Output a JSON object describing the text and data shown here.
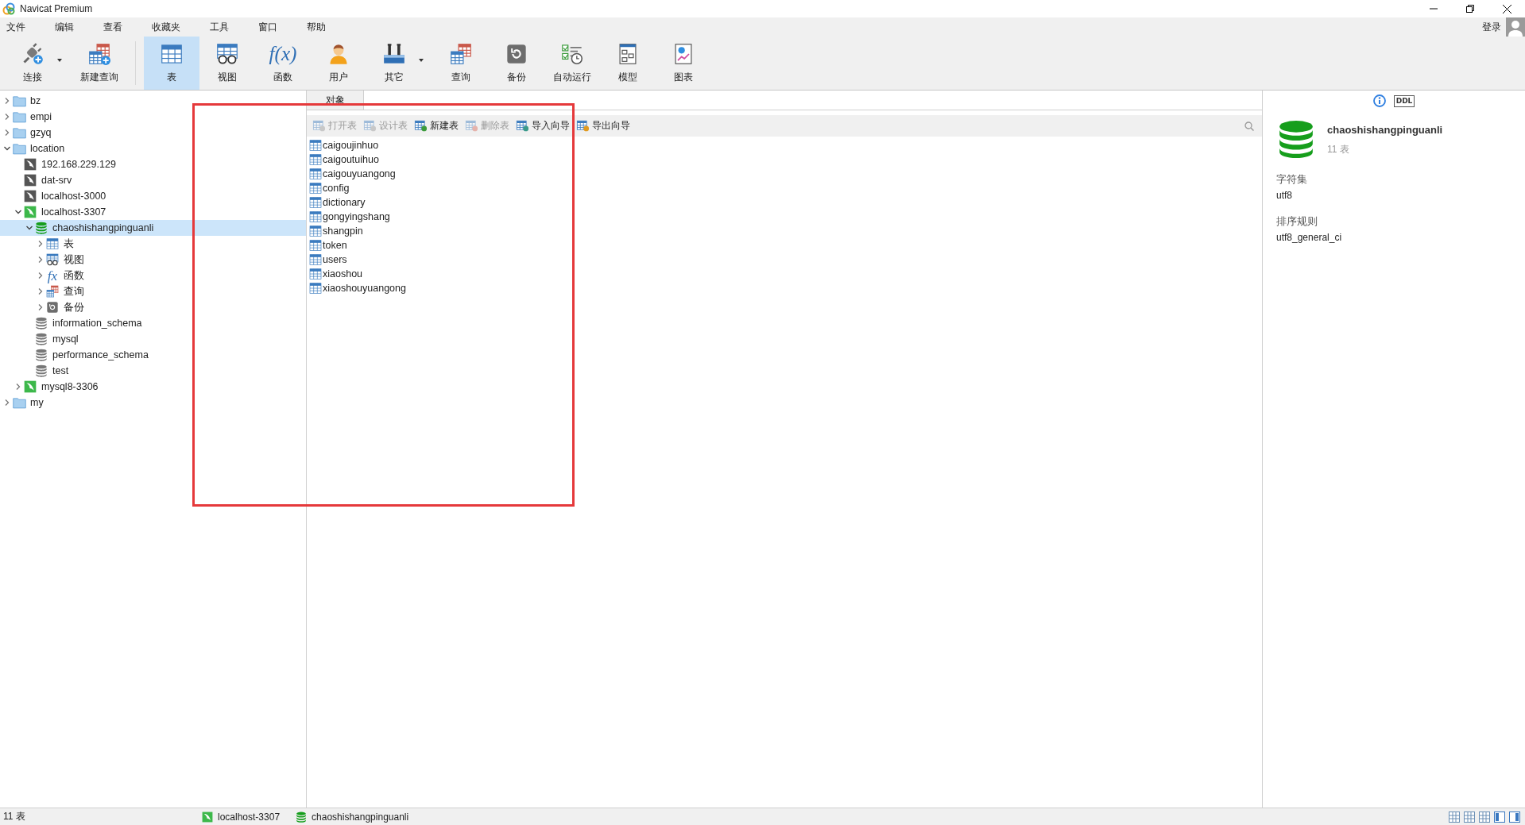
{
  "window": {
    "title": "Navicat Premium"
  },
  "menu": [
    "文件",
    "编辑",
    "查看",
    "收藏夹",
    "工具",
    "窗口",
    "帮助"
  ],
  "account": {
    "label": "登录"
  },
  "toolbar": [
    {
      "label": "连接",
      "kind": "connect",
      "selected": false,
      "dropdown": true
    },
    {
      "label": "新建查询",
      "kind": "newquery",
      "selected": false,
      "dropdown": false
    },
    {
      "label": "表",
      "kind": "table",
      "selected": true,
      "dropdown": false
    },
    {
      "label": "视图",
      "kind": "view",
      "selected": false,
      "dropdown": false
    },
    {
      "label": "函数",
      "kind": "function",
      "glyph": "f(x)",
      "selected": false,
      "dropdown": false
    },
    {
      "label": "用户",
      "kind": "user",
      "selected": false,
      "dropdown": false
    },
    {
      "label": "其它",
      "kind": "tools",
      "selected": false,
      "dropdown": true
    },
    {
      "label": "查询",
      "kind": "query",
      "selected": false,
      "dropdown": false
    },
    {
      "label": "备份",
      "kind": "backup",
      "selected": false,
      "dropdown": false
    },
    {
      "label": "自动运行",
      "kind": "auto",
      "selected": false,
      "dropdown": false
    },
    {
      "label": "模型",
      "kind": "model",
      "selected": false,
      "dropdown": false
    },
    {
      "label": "图表",
      "kind": "chart",
      "selected": false,
      "dropdown": false
    }
  ],
  "tree": [
    {
      "kind": "folder",
      "label": "bz",
      "expanded": false,
      "selected": false
    },
    {
      "kind": "folder",
      "label": "empi",
      "expanded": false,
      "selected": false
    },
    {
      "kind": "folder",
      "label": "gzyq",
      "expanded": false,
      "selected": false
    },
    {
      "kind": "folder",
      "label": "location",
      "expanded": true,
      "selected": false,
      "children": [
        {
          "kind": "connection",
          "label": "192.168.229.129",
          "connected": false,
          "selected": false
        },
        {
          "kind": "connection",
          "label": "dat-srv",
          "connected": false,
          "selected": false
        },
        {
          "kind": "connection",
          "label": "localhost-3000",
          "connected": false,
          "selected": false
        },
        {
          "kind": "connection",
          "label": "localhost-3307",
          "connected": true,
          "expanded": true,
          "selected": false,
          "children": [
            {
              "kind": "database",
              "label": "chaoshishangpinguanli",
              "open": true,
              "expanded": true,
              "selected": true,
              "children": [
                {
                  "kind": "table",
                  "label": "表",
                  "expanded": false,
                  "selected": false
                },
                {
                  "kind": "view",
                  "label": "视图",
                  "expanded": false,
                  "selected": false
                },
                {
                  "kind": "function",
                  "glyph": "fx",
                  "label": "函数",
                  "expanded": false,
                  "selected": false
                },
                {
                  "kind": "query",
                  "label": "查询",
                  "expanded": false,
                  "selected": false
                },
                {
                  "kind": "backup",
                  "label": "备份",
                  "expanded": false,
                  "selected": false
                }
              ]
            },
            {
              "kind": "database",
              "label": "information_schema",
              "open": false,
              "selected": false
            },
            {
              "kind": "database",
              "label": "mysql",
              "open": false,
              "selected": false
            },
            {
              "kind": "database",
              "label": "performance_schema",
              "open": false,
              "selected": false
            },
            {
              "kind": "database",
              "label": "test",
              "open": false,
              "selected": false
            }
          ]
        },
        {
          "kind": "connection",
          "label": "mysql8-3306",
          "connected": true,
          "expanded": false,
          "selected": false
        }
      ]
    },
    {
      "kind": "folder",
      "label": "my",
      "expanded": false,
      "selected": false
    }
  ],
  "object_tabs": [
    {
      "label": "对象",
      "selected": true
    }
  ],
  "object_actions": [
    {
      "label": "打开表",
      "kind": "open",
      "disabled": true
    },
    {
      "label": "设计表",
      "kind": "design",
      "disabled": true
    },
    {
      "label": "新建表",
      "kind": "new",
      "disabled": false
    },
    {
      "label": "删除表",
      "kind": "delete",
      "disabled": true
    },
    {
      "label": "导入向导",
      "kind": "import",
      "disabled": false
    },
    {
      "label": "导出向导",
      "kind": "export",
      "disabled": false
    }
  ],
  "objects": [
    "caigoujinhuo",
    "caigoutuihuo",
    "caigouyuangong",
    "config",
    "dictionary",
    "gongyingshang",
    "shangpin",
    "token",
    "users",
    "xiaoshou",
    "xiaoshouyuangong"
  ],
  "info": {
    "ddl_label": "DDL",
    "name": "chaoshishangpinguanli",
    "count": "11 表",
    "fields": [
      {
        "label": "字符集",
        "value": "utf8"
      },
      {
        "label": "排序规则",
        "value": "utf8_general_ci"
      }
    ]
  },
  "status_bar": {
    "count": "11 表",
    "connection": "localhost-3307",
    "database": "chaoshishangpinguanli"
  }
}
